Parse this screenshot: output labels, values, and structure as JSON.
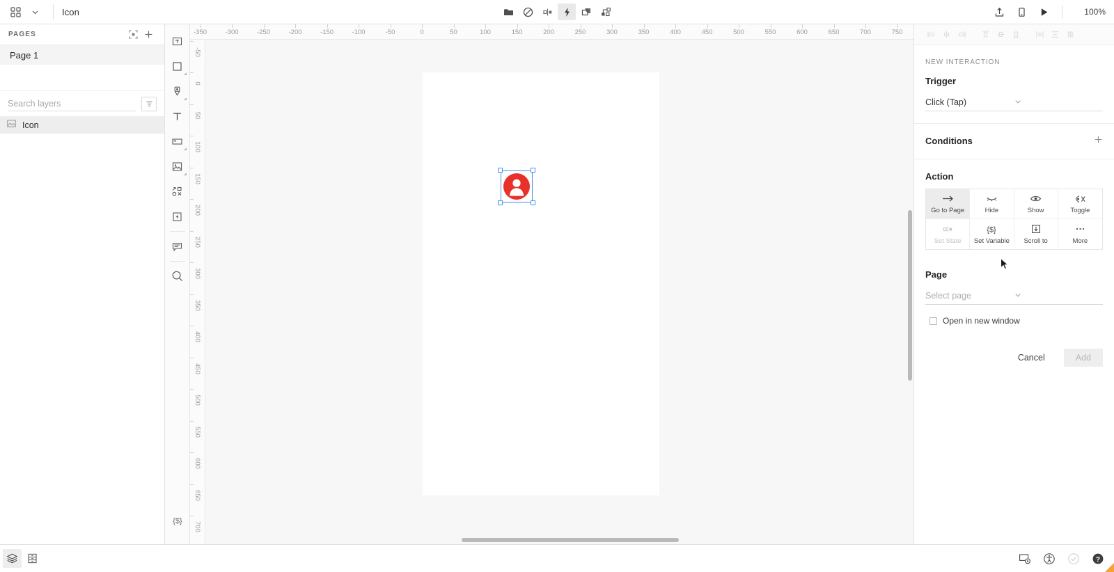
{
  "topbar": {
    "apps_icon": "grid-apps-icon",
    "chevron_icon": "chevron-down-icon",
    "document_title": "Icon",
    "tools": [
      {
        "name": "folder-icon",
        "label": "Folder",
        "active": false
      },
      {
        "name": "no-entry-icon",
        "label": "Restrict",
        "active": false
      },
      {
        "name": "distribute-icon",
        "label": "Distribute",
        "active": false
      },
      {
        "name": "lightning-bolt-icon",
        "label": "Interactions",
        "active": true
      },
      {
        "name": "layers-stack-icon",
        "label": "Layers",
        "active": false
      },
      {
        "name": "components-icon",
        "label": "Components",
        "active": false
      }
    ],
    "right_tools": [
      {
        "name": "share-upload-icon",
        "label": "Share"
      },
      {
        "name": "device-preview-icon",
        "label": "Preview device"
      },
      {
        "name": "play-icon",
        "label": "Play"
      }
    ],
    "zoom_level": "100%"
  },
  "sidebar": {
    "pages_header": "PAGES",
    "pages_actions": [
      {
        "name": "fit-frame-icon",
        "label": "Fit"
      },
      {
        "name": "plus-icon",
        "label": "Add page"
      }
    ],
    "pages": [
      {
        "label": "Page 1",
        "selected": true
      }
    ],
    "search": {
      "placeholder": "Search layers",
      "value": "",
      "filter_icon": "filter-icon"
    },
    "layers": [
      {
        "label": "Icon",
        "icon": "image-layer-icon",
        "selected": true
      }
    ]
  },
  "toolrail": {
    "tools": [
      {
        "name": "text-field-tool",
        "label": "Text field"
      },
      {
        "name": "rectangle-tool",
        "label": "Rectangle"
      },
      {
        "name": "pen-tool",
        "label": "Pen"
      },
      {
        "name": "text-tool",
        "label": "Text"
      },
      {
        "name": "container-tool",
        "label": "Container"
      },
      {
        "name": "image-tool",
        "label": "Image"
      },
      {
        "name": "shapes-tool",
        "label": "Shapes"
      },
      {
        "name": "hotspot-tool",
        "label": "Hotspot"
      },
      {
        "name": "comment-tool",
        "label": "Comment"
      }
    ],
    "bottom_tool": {
      "name": "variables-tool",
      "label": "{$}"
    }
  },
  "canvas": {
    "ruler_h": {
      "labels": [
        "-350",
        "-300",
        "-250",
        "-200",
        "-150",
        "-100",
        "-50",
        "0",
        "50",
        "100",
        "150",
        "200",
        "250",
        "300",
        "350",
        "400",
        "450",
        "500",
        "550",
        "600",
        "650",
        "700",
        "750"
      ],
      "start": -350,
      "step": 50
    },
    "ruler_v": {
      "labels": [
        "-50",
        "0",
        "50",
        "100",
        "150",
        "200",
        "250",
        "300",
        "350",
        "400",
        "450",
        "500",
        "550",
        "600",
        "650",
        "700"
      ],
      "start": -50,
      "step": 50
    },
    "selection": {
      "name": "Icon",
      "icon": "user-avatar-icon",
      "color": "#e8312a",
      "handle_color": "#4a90e2"
    },
    "artboard_background": "#ffffff",
    "canvas_background": "#f7f7f7"
  },
  "right_panel": {
    "align_icons": [
      "align-left-icon",
      "align-center-horizontal-icon",
      "align-right-icon",
      "align-top-icon",
      "align-middle-vertical-icon",
      "align-bottom-icon",
      "distribute-horizontal-icon",
      "distribute-vertical-icon",
      "grid-icon"
    ],
    "heading": "NEW INTERACTION",
    "trigger": {
      "label": "Trigger",
      "value": "Click (Tap)"
    },
    "conditions": {
      "label": "Conditions",
      "add_icon": "plus-icon"
    },
    "action": {
      "label": "Action",
      "items": [
        {
          "label": "Go to Page",
          "icon": "arrow-right-icon",
          "selected": true,
          "disabled": false
        },
        {
          "label": "Hide",
          "icon": "eye-closed-icon",
          "selected": false,
          "disabled": false
        },
        {
          "label": "Show",
          "icon": "eye-open-icon",
          "selected": false,
          "disabled": false
        },
        {
          "label": "Toggle",
          "icon": "toggle-eye-icon",
          "selected": false,
          "disabled": false
        },
        {
          "label": "Set State",
          "icon": "set-state-icon",
          "selected": false,
          "disabled": true
        },
        {
          "label": "Set Variable",
          "icon": "variable-icon",
          "selected": false,
          "disabled": false
        },
        {
          "label": "Scroll to",
          "icon": "scroll-to-icon",
          "selected": false,
          "disabled": false
        },
        {
          "label": "More",
          "icon": "ellipsis-icon",
          "selected": false,
          "disabled": false
        }
      ]
    },
    "page": {
      "label": "Page",
      "placeholder": "Select page",
      "value": ""
    },
    "open_new_window": {
      "label": "Open in new window",
      "checked": false
    },
    "buttons": {
      "cancel": "Cancel",
      "add": "Add"
    }
  },
  "bottombar": {
    "left_tools": [
      {
        "name": "layers-panel-icon",
        "label": "Layers panel",
        "active": true
      },
      {
        "name": "assets-panel-icon",
        "label": "Assets panel",
        "active": false
      }
    ],
    "right_tools": [
      {
        "name": "screen-settings-icon",
        "label": "Screen settings"
      },
      {
        "name": "accessibility-icon",
        "label": "Accessibility"
      },
      {
        "name": "check-circle-icon",
        "label": "Status"
      },
      {
        "name": "help-icon",
        "label": "Help"
      }
    ]
  }
}
